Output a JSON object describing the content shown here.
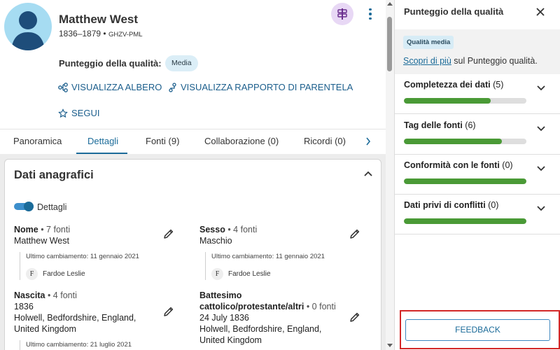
{
  "person": {
    "name": "Matthew West",
    "lifespan": "1836–1879",
    "pid": "GHZV-PML"
  },
  "quality": {
    "label": "Punteggio della qualità:",
    "badge": "Media"
  },
  "actions": {
    "tree": "VISUALIZZA ALBERO",
    "relationship": "VISUALIZZA RAPPORTO DI PARENTELA",
    "follow": "SEGUI"
  },
  "tabs": [
    {
      "label": "Panoramica"
    },
    {
      "label": "Dettagli"
    },
    {
      "label": "Fonti (9)"
    },
    {
      "label": "Collaborazione (0)"
    },
    {
      "label": "Ricordi (0)"
    }
  ],
  "active_tab": "Dettagli",
  "card": {
    "title": "Dati anagrafici",
    "toggle_label": "Dettagli"
  },
  "fields": {
    "name": {
      "label": "Nome",
      "count": " • 7 fonti",
      "value": "Matthew West",
      "changed": "Ultimo cambiamento: 11 gennaio 2021",
      "by_initial": "F",
      "by": "Fardoe Leslie"
    },
    "sex": {
      "label": "Sesso",
      "count": " • 4 fonti",
      "value": "Maschio",
      "changed": "Ultimo cambiamento: 11 gennaio 2021",
      "by_initial": "F",
      "by": "Fardoe Leslie"
    },
    "birth": {
      "label": "Nascita",
      "count": " • 4 fonti",
      "line1": "1836",
      "line2": "Holwell, Bedfordshire, England,",
      "line3": "United Kingdom",
      "changed": "Ultimo cambiamento: 21 luglio 2021"
    },
    "baptism": {
      "label_line1": "Battesimo",
      "label_line2": "cattolico/protestante/altri",
      "count": " • 0 fonti",
      "line1": "24 July 1836",
      "line2": "Holwell, Bedfordshire, England,",
      "line3": "United Kingdom"
    }
  },
  "panel": {
    "title": "Punteggio della qualità",
    "badge": "Qualità media",
    "learn_link": "Scopri di più",
    "learn_rest": " sul Punteggio qualità.",
    "categories": [
      {
        "label": "Completezza dei dati",
        "count": "(5)",
        "score": 0.71
      },
      {
        "label": "Tag delle fonti",
        "count": "(6)",
        "score": 0.8
      },
      {
        "label": "Conformità con le fonti",
        "count": "(0)",
        "score": 1.0
      },
      {
        "label": "Dati privi di conflitti",
        "count": "(0)",
        "score": 1.0
      }
    ],
    "feedback": "FEEDBACK"
  },
  "colors": {
    "accent": "#1b6b99",
    "score_fill": "#4a9a36",
    "highlight_border": "#d32727"
  },
  "icons": [
    "avatar-silhouette-icon",
    "signpost-icon",
    "more-vert-icon",
    "tree-icon",
    "relationship-icon",
    "star-outline-icon",
    "chevron-right-icon",
    "chevron-up-icon",
    "pencil-icon",
    "close-icon",
    "chevron-down-icon"
  ]
}
